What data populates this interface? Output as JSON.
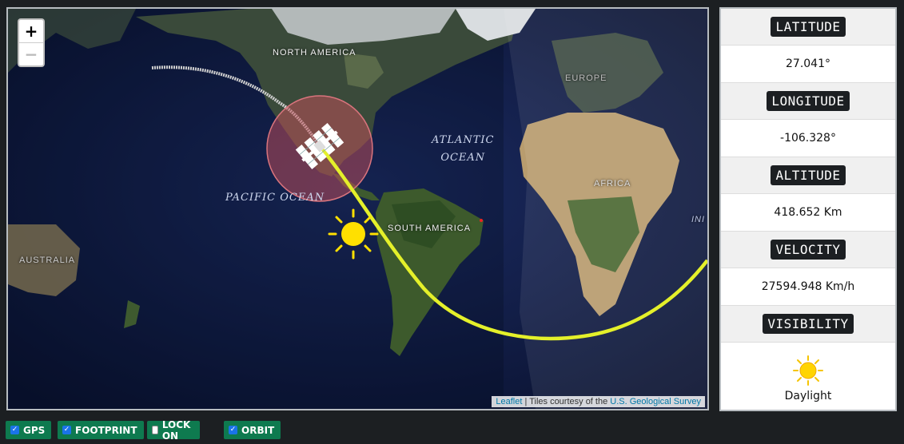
{
  "map": {
    "zoom_in": "+",
    "zoom_out": "−",
    "attribution": {
      "leaflet": "Leaflet",
      "separator": " | Tiles courtesy of the ",
      "provider": "U.S. Geological Survey"
    },
    "labels": {
      "north_america": "NORTH AMERICA",
      "south_america": "SOUTH AMERICA",
      "europe": "EUROPE",
      "africa": "AFRICA",
      "australia": "AUSTRALIA",
      "india_partial": "INI",
      "pacific_ocean": "PACIFIC OCEAN",
      "atlantic_line1": "ATLANTIC",
      "atlantic_line2": "OCEAN"
    },
    "icons": [
      "iss-satellite-icon",
      "sun-icon"
    ],
    "colors": {
      "orbit": "#e4f02a",
      "past_track": "#cfcfcf",
      "footprint": "#c8505a",
      "sun": "#ffe000"
    }
  },
  "panel": {
    "latitude_label": "LATITUDE",
    "latitude_value": "27.041°",
    "longitude_label": "LONGITUDE",
    "longitude_value": "-106.328°",
    "altitude_label": "ALTITUDE",
    "altitude_value": "418.652 Km",
    "velocity_label": "VELOCITY",
    "velocity_value": "27594.948 Km/h",
    "visibility_label": "VISIBILITY",
    "visibility_icon": "sun-icon",
    "visibility_value": "Daylight"
  },
  "controls": [
    {
      "label": "GPS",
      "checked": true
    },
    {
      "label": "FOOTPRINT",
      "checked": true
    },
    {
      "label": "LOCK ON",
      "checked": false
    },
    {
      "label": "ORBIT",
      "checked": true
    }
  ],
  "accent_color": "#0e7a4f"
}
